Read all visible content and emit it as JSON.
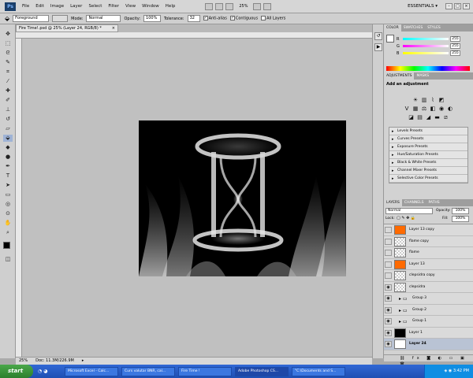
{
  "menubar": {
    "logo": "Ps",
    "items": [
      "File",
      "Edit",
      "Image",
      "Layer",
      "Select",
      "Filter",
      "View",
      "Window",
      "Help"
    ],
    "zoom": "25%",
    "workspace": "ESSENTIALS ▾"
  },
  "options": {
    "fill": "Foreground",
    "mode_label": "Mode:",
    "mode": "Normal",
    "opacity_label": "Opacity:",
    "opacity": "100%",
    "tolerance_label": "Tolerance:",
    "tolerance": "32",
    "antialias": "Anti-alias",
    "contiguous": "Contiguous",
    "all_layers": "All Layers"
  },
  "document": {
    "tab_title": "Fire Time!.psd @ 25% (Layer 24, RGB/8) *"
  },
  "status": {
    "zoom": "25%",
    "doc": "Doc: 11.3M/226.9M"
  },
  "color_panel": {
    "tabs": [
      "COLOR",
      "SWATCHES",
      "STYLES"
    ],
    "channels": [
      {
        "label": "R",
        "value": "255"
      },
      {
        "label": "G",
        "value": "255"
      },
      {
        "label": "B",
        "value": "255"
      }
    ]
  },
  "adjustments": {
    "tabs": [
      "ADJUSTMENTS",
      "MASKS"
    ],
    "heading": "Add an adjustment",
    "presets": [
      "Levels Presets",
      "Curves Presets",
      "Exposure Presets",
      "Hue/Saturation Presets",
      "Black & White Presets",
      "Channel Mixer Presets",
      "Selective Color Presets"
    ]
  },
  "layers_panel": {
    "tabs": [
      "LAYERS",
      "CHANNELS",
      "PATHS"
    ],
    "blend": "Normal",
    "opacity_label": "Opacity:",
    "opacity": "100%",
    "lock_label": "Lock:",
    "fill_label": "Fill:",
    "fill": "100%",
    "layers": [
      {
        "name": "Layer 13 copy",
        "kind": "orange",
        "visible": false
      },
      {
        "name": "flame copy",
        "kind": "transparent",
        "visible": false
      },
      {
        "name": "flame",
        "kind": "transparent",
        "visible": false
      },
      {
        "name": "Layer 13",
        "kind": "orange",
        "visible": false
      },
      {
        "name": "clepsidra copy",
        "kind": "transparent",
        "visible": false
      },
      {
        "name": "clepsidra",
        "kind": "transparent",
        "visible": true
      },
      {
        "name": "Group 3",
        "kind": "group",
        "visible": true
      },
      {
        "name": "Group 2",
        "kind": "group",
        "visible": true
      },
      {
        "name": "Group 1",
        "kind": "group",
        "visible": true
      },
      {
        "name": "Layer 1",
        "kind": "black",
        "visible": true
      },
      {
        "name": "Layer 24",
        "kind": "white",
        "visible": true
      }
    ]
  },
  "taskbar": {
    "start": "start",
    "items": [
      "Microsoft Excel - Calc...",
      "Curs valutar BNR, cal...",
      "Fire Time !",
      "Adobe Photoshop CS...",
      "\"C:\\Documents and S..."
    ],
    "time": "3:42 PM"
  },
  "colors": {
    "orange": "#ff6a00",
    "selected_row": "#b9c3d4"
  }
}
